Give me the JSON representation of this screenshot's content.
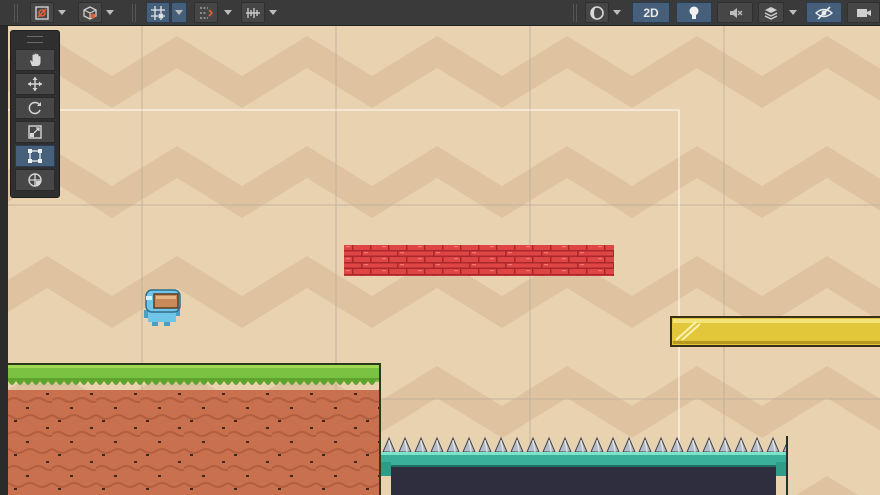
{
  "toolbar": {
    "mode_2d_label": "2D",
    "left_group": [
      {
        "icon": "gizmo-draw-mode-icon",
        "has_dropdown": true
      },
      {
        "icon": "shaded-cube-icon",
        "has_dropdown": true
      }
    ],
    "snap_group": [
      {
        "icon": "grid-snap-icon",
        "has_dropdown": true,
        "active": true
      },
      {
        "icon": "increment-snap-icon",
        "has_dropdown": true,
        "active": false
      },
      {
        "icon": "ruler-icon",
        "has_dropdown": true,
        "active": false
      }
    ],
    "right_group": [
      {
        "icon": "shading-sphere-icon",
        "has_dropdown": true
      },
      {
        "icon": "2d-toggle",
        "active": true
      },
      {
        "icon": "lighting-bulb-icon",
        "active": true
      },
      {
        "icon": "audio-mute-icon",
        "active": false
      },
      {
        "icon": "effects-layers-icon",
        "has_dropdown": true
      },
      {
        "icon": "hidden-objects-eye-icon",
        "active": true
      },
      {
        "icon": "camera-icon",
        "active": false
      }
    ]
  },
  "tool_palette": {
    "tools": [
      {
        "name": "hand-tool",
        "icon": "hand-icon",
        "active": false
      },
      {
        "name": "move-tool",
        "icon": "move-arrows-icon",
        "active": false
      },
      {
        "name": "rotate-tool",
        "icon": "rotate-icon",
        "active": false
      },
      {
        "name": "scale-tool",
        "icon": "scale-icon",
        "active": false
      },
      {
        "name": "rect-tool",
        "icon": "rect-transform-icon",
        "active": true
      },
      {
        "name": "transform-tool",
        "icon": "transform-icon",
        "active": false
      }
    ]
  },
  "scene": {
    "background_colors": {
      "light": "#e9d2b0",
      "chevron": "#dfc3a0"
    },
    "objects": [
      {
        "name": "player",
        "color": "#6fc6e8"
      },
      {
        "name": "grass-ground",
        "grass": "#7cc242",
        "dirt": "#c9714e"
      },
      {
        "name": "brick-platform",
        "color": "#e04545"
      },
      {
        "name": "gold-platform",
        "color": "#e2c73a"
      },
      {
        "name": "spike-pit",
        "color": "#3ab09a",
        "spikes": "#b6bcc4"
      }
    ],
    "grid_color": "#b8aa99",
    "camera_bounds_color": "#ffffff"
  }
}
